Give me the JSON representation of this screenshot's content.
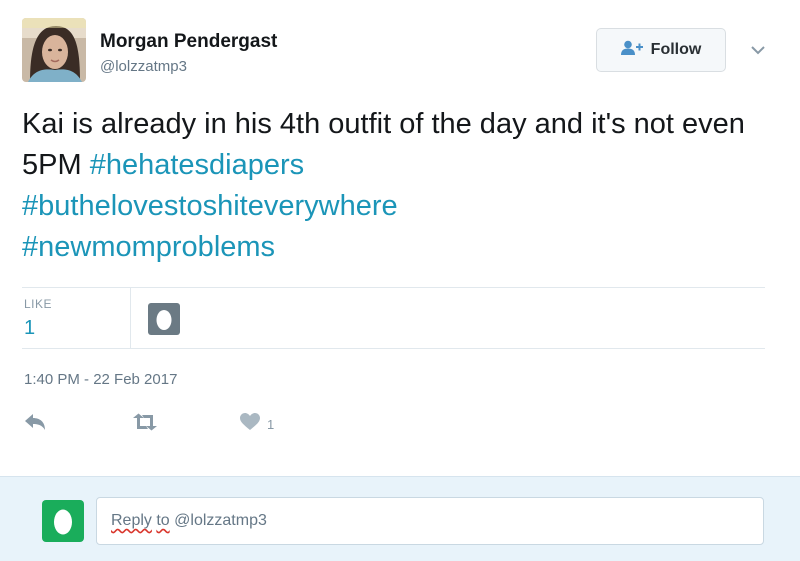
{
  "user": {
    "name": "Morgan Pendergast",
    "handle": "@lolzzatmp3"
  },
  "follow_button": {
    "label": "Follow",
    "icon": "add-user-icon"
  },
  "tweet": {
    "segments": [
      {
        "text": "Kai is already in his 4th outfit of the day and it's not even 5PM ",
        "type": "text"
      },
      {
        "text": "#hehatesdiapers",
        "type": "hashtag"
      },
      {
        "text": " ",
        "type": "text"
      },
      {
        "text": "#buthelovestoshiteverywhere",
        "type": "hashtag"
      },
      {
        "text": " ",
        "type": "text"
      },
      {
        "text": "#newmomproblems",
        "type": "hashtag"
      }
    ]
  },
  "stats": {
    "label": "LIKE",
    "value": "1"
  },
  "timestamp": "1:40 PM - 22 Feb 2017",
  "actions": {
    "reply_icon": "reply-arrow-icon",
    "retweet_icon": "retweet-icon",
    "like_icon": "heart-icon",
    "like_count": "1"
  },
  "reply_box": {
    "placeholder_prefix": "Reply",
    "placeholder_mid": " ",
    "placeholder_to": "to",
    "placeholder_handle": " @lolzzatmp3"
  },
  "colors": {
    "hashtag": "#1b95b8",
    "egg_green": "#1aad5b",
    "liker_gray": "#6b7a84",
    "reply_bg": "#e8f3fa"
  }
}
